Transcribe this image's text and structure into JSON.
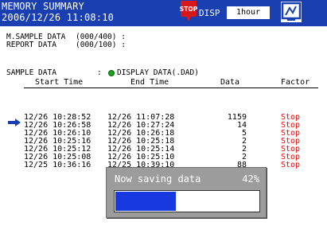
{
  "header": {
    "title_line1": "MEMORY SUMMARY",
    "title_line2": "2006/12/26 11:08:10",
    "stop_badge": "STOP",
    "disp_label": "DISP",
    "interval_button": "1hour",
    "monitor_icon": "monitor-icon",
    "colors": {
      "bar": "#1a3fb0",
      "stop_badge": "#d81818"
    }
  },
  "summary": {
    "m_sample_label": "M.SAMPLE DATA",
    "m_sample_value": "(000/400) :",
    "report_label": "REPORT DATA",
    "report_value": "(000/100) :"
  },
  "sample": {
    "label": "SAMPLE DATA",
    "colon": ":",
    "status_icon": "green-dot-icon",
    "value": "DISPLAY DATA(.DAD)"
  },
  "table": {
    "columns": [
      "Start Time",
      "End Time",
      "Data",
      "Factor"
    ],
    "rows": [
      {
        "start": "12/26 10:28:52",
        "end": "12/26 11:07:28",
        "data": "1159",
        "factor": "Stop"
      },
      {
        "start": "12/26 10:26:58",
        "end": "12/26 10:27:24",
        "data": "14",
        "factor": "Stop"
      },
      {
        "start": "12/26 10:26:10",
        "end": "12/26 10:26:18",
        "data": "5",
        "factor": "Stop"
      },
      {
        "start": "12/26 10:25:16",
        "end": "12/26 10:25:18",
        "data": "2",
        "factor": "Stop"
      },
      {
        "start": "12/26 10:25:12",
        "end": "12/26 10:25:14",
        "data": "2",
        "factor": "Stop"
      },
      {
        "start": "12/26 10:25:08",
        "end": "12/26 10:25:10",
        "data": "2",
        "factor": "Stop"
      },
      {
        "start": "12/25 10:36:16",
        "end": "12/25 10:39:10",
        "data": "88",
        "factor": "Stop"
      }
    ],
    "factor_color": "#ff0000",
    "cursor_icon": "arrow-right-icon"
  },
  "dialog": {
    "message": "Now saving data",
    "percent_text": "42%",
    "progress": 0.42
  }
}
